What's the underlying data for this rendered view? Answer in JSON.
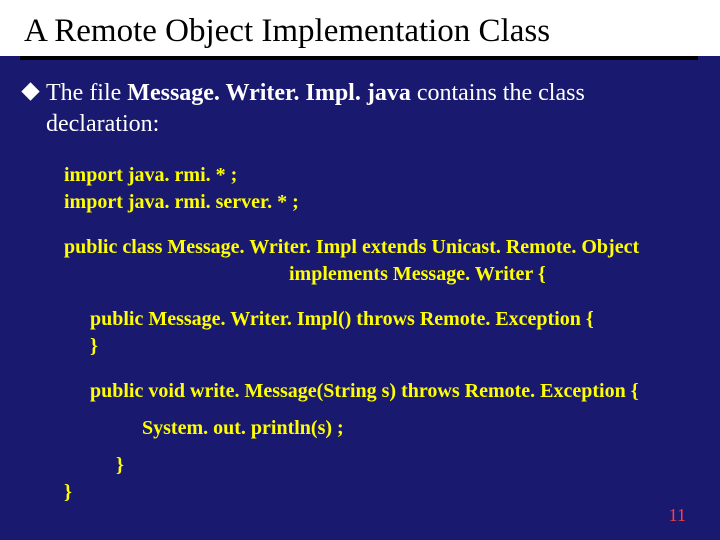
{
  "title": "A Remote Object Implementation Class",
  "bullet": {
    "pre": "The file ",
    "file": "Message. Writer. Impl. java",
    "post": " contains the class declaration:"
  },
  "code": {
    "imp1": "import java. rmi. * ;",
    "imp2": "import java. rmi. server. * ;",
    "cls1": "public class Message. Writer. Impl extends Unicast. Remote. Object",
    "cls2": "implements Message. Writer {",
    "ctor": "public Message. Writer. Impl() throws Remote. Exception {",
    "ctorEnd": "}",
    "wm": "public void write. Message(String s) throws Remote. Exception {",
    "sout": "System. out. println(s) ;",
    "wmEnd": "}",
    "clsEnd": "}"
  },
  "page": "11"
}
